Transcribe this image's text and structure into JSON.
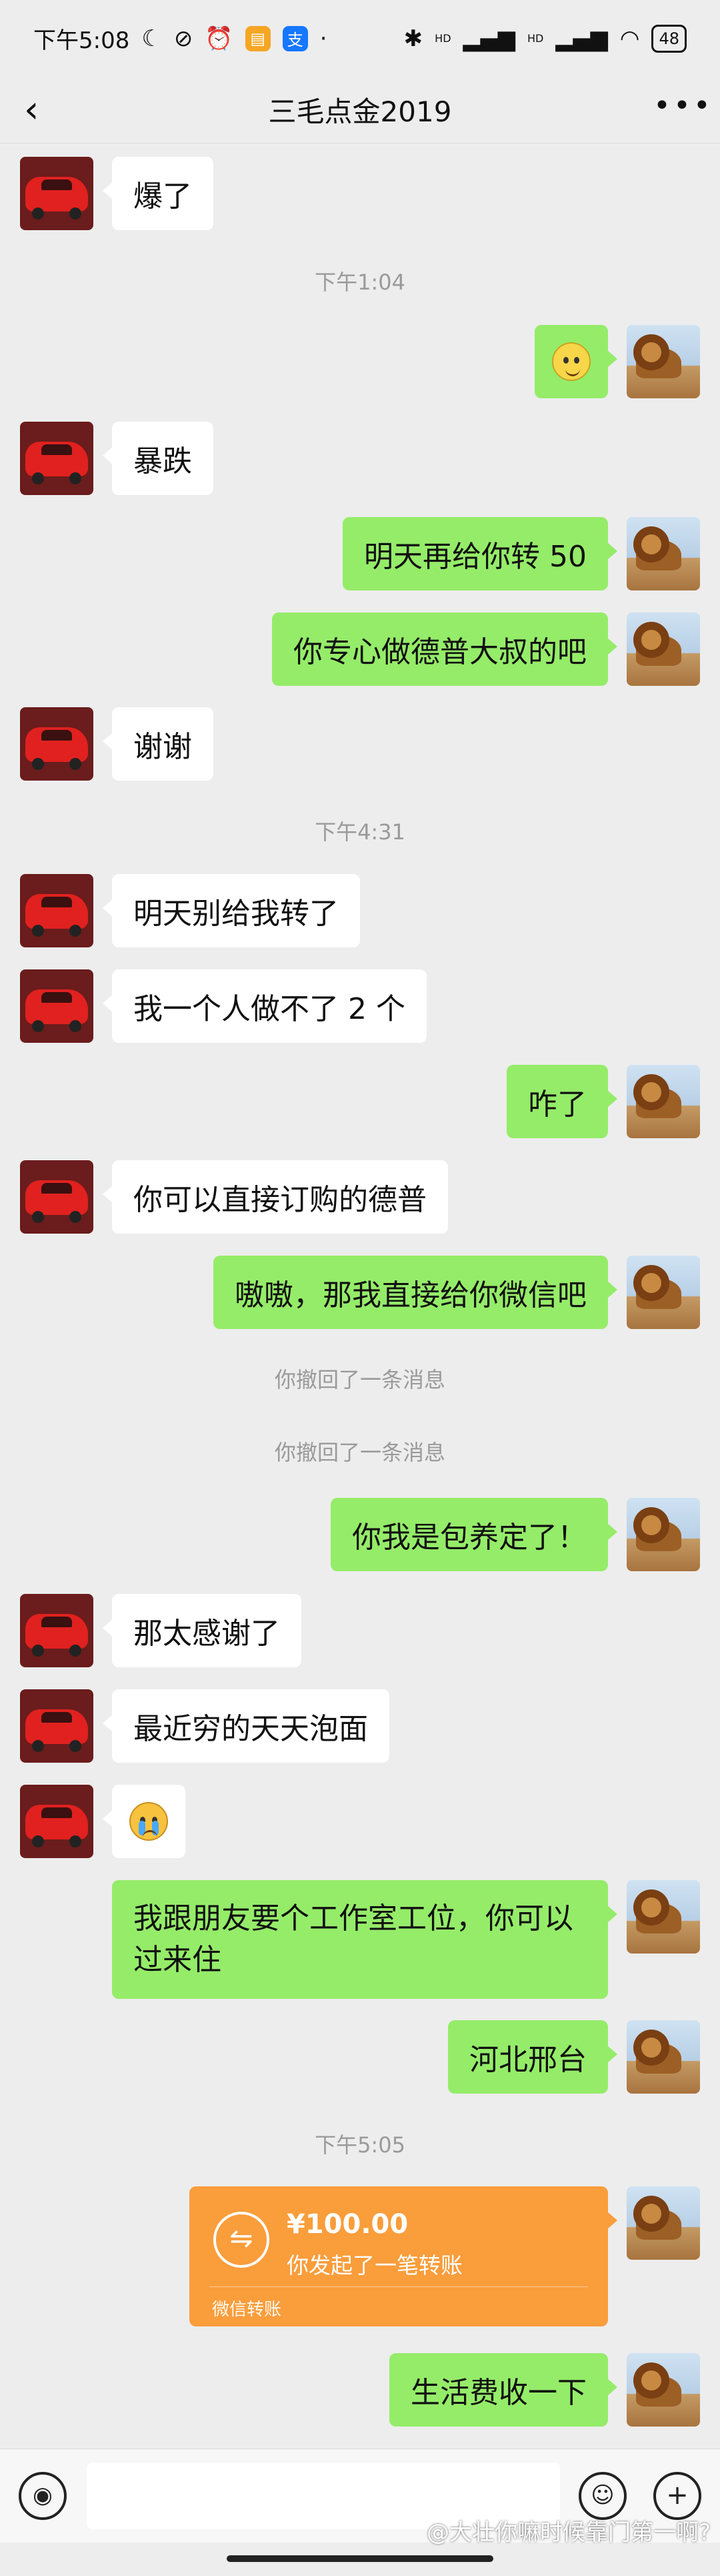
{
  "status_bar": {
    "time": "下午5:08",
    "left_icons": [
      "moon-icon",
      "mute-icon",
      "alarm-icon",
      "app-icon",
      "alipay-icon",
      "dot-icon"
    ],
    "right_icons": [
      "bluetooth-icon",
      "signal-1-icon",
      "signal-2-icon",
      "wifi-icon"
    ],
    "signal_label": "HD",
    "battery": "48"
  },
  "header": {
    "title": "三毛点金2019",
    "back_icon": "‹",
    "more_icon": "•••"
  },
  "messages": {
    "m1": "爆了",
    "t1": "下午1:04",
    "m2_emoji": "smile-emoji",
    "m3": "暴跌",
    "m4": "明天再给你转 50",
    "m5": "你专心做德普大叔的吧",
    "m6": "谢谢",
    "t2": "下午4:31",
    "m7": "明天别给我转了",
    "m8": "我一个人做不了 2 个",
    "m9": "咋了",
    "m10": "你可以直接订购的德普",
    "m11": "嗷嗷，那我直接给你微信吧",
    "s1": "你撤回了一条消息",
    "s2": "你撤回了一条消息",
    "m12": "你我是包养定了！",
    "m13": "那太感谢了",
    "m14": "最近穷的天天泡面",
    "m15_emoji": "crying-emoji",
    "m16": "我跟朋友要个工作室工位，你可以过来住",
    "m17": "河北邢台",
    "t3": "下午5:05",
    "transfer": {
      "amount": "¥100.00",
      "desc": "你发起了一笔转账",
      "footer": "微信转账",
      "icon": "⇋"
    },
    "m18": "生活费收一下"
  },
  "input_bar": {
    "voice_icon": "voice-icon",
    "emoji_icon": "emoji-icon",
    "plus_icon": "+"
  },
  "watermark": "@大壮你嘛时候靠门第一啊?",
  "colors": {
    "background": "#ededed",
    "sent_bubble": "#95ec69",
    "received_bubble": "#ffffff",
    "transfer": "#fa9d3b"
  }
}
